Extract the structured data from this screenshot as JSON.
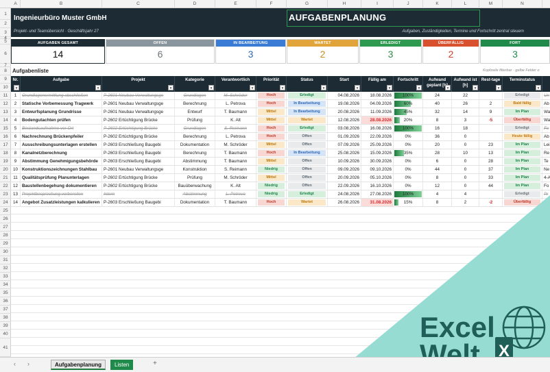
{
  "columns": [
    "A",
    "B",
    "C",
    "D",
    "E",
    "F",
    "G",
    "H",
    "I",
    "J",
    "K",
    "L",
    "M",
    "N",
    "O"
  ],
  "rows": [
    "1",
    "2",
    "3",
    "4",
    "5",
    "6",
    "7",
    "8",
    "9",
    "10",
    "11",
    "12",
    "13",
    "14",
    "15",
    "16",
    "17",
    "18",
    "19",
    "20",
    "21",
    "22",
    "23",
    "24",
    "25",
    "26",
    "27",
    "28",
    "29",
    "30",
    "31",
    "32",
    "33",
    "34",
    "35",
    "36",
    "37",
    "38",
    "39",
    "40",
    "41"
  ],
  "header": {
    "company": "Ingenieurbüro Muster GmbH",
    "sheet_title": "AUFGABENPLANUNG",
    "subtitle": "Projekt- und Teamübersicht · Geschäftsjahr 27",
    "subtitle_right": "Aufgaben, Zuständigkeiten, Termine und Fortschritt zentral steuern"
  },
  "kpis": [
    {
      "label": "AUFGABEN GESAMT",
      "value": "14",
      "color": "#1d2b34",
      "text": "#111111"
    },
    {
      "label": "OFFEN",
      "value": "6",
      "color": "#8a969d",
      "text": "#6b7378"
    },
    {
      "label": "IN BEARBEITUNG",
      "value": "3",
      "color": "#3a7bd5",
      "text": "#2d66b8"
    },
    {
      "label": "WARTET",
      "value": "2",
      "color": "#e0a43a",
      "text": "#c98d23"
    },
    {
      "label": "ERLEDIGT",
      "value": "3",
      "color": "#2e9a4f",
      "text": "#2e8a48"
    },
    {
      "label": "ÜBERFÄLLIG",
      "value": "2",
      "color": "#d9502f",
      "text": "#c8432a"
    },
    {
      "label": "FORT",
      "value": "3",
      "color": "#1f8a4a",
      "text": "#1f8a4a"
    }
  ],
  "list_label": "Aufgabenliste",
  "list_hint": "Kopfzeile filterbar · gelbe Felder o",
  "table": {
    "headers": [
      "Nr.",
      "Aufgabe",
      "Projekt",
      "Kategorie",
      "Verantwortlich",
      "Priorität",
      "Status",
      "Start",
      "Fällig am",
      "Fortschritt",
      "Aufwand geplant [h]",
      "Aufwand ist [h]",
      "Rest-tage",
      "Terminstatus",
      "N"
    ],
    "rows": [
      {
        "nr": "1",
        "task": "Grundlagenermittlung abschließen",
        "project": "P-2601 Neubau Verwaltungsge",
        "category": "Grundlagen",
        "owner": "M. Schröder",
        "prio": "Hoch",
        "status": "Erledigt",
        "start": "04.08.2026",
        "due": "18.08.2026",
        "progress": "100%",
        "progress_value": 1.0,
        "plan": "24",
        "actual": "22",
        "rest": "",
        "termin": "Erledigt",
        "note": "Un",
        "done": true,
        "due_red": false,
        "rest_red": false
      },
      {
        "nr": "2",
        "task": "Statische Vorbemessung Tragwerk",
        "project": "P-2601 Neubau Verwaltungsge",
        "category": "Berechnung",
        "owner": "L. Petrova",
        "prio": "Hoch",
        "status": "In Bearbeitung",
        "start": "19.08.2026",
        "due": "04.09.2026",
        "progress": "60%",
        "progress_value": 0.6,
        "plan": "40",
        "actual": "26",
        "rest": "2",
        "termin": "Bald fällig",
        "note": "Ab",
        "done": false,
        "due_red": false,
        "rest_red": false
      },
      {
        "nr": "3",
        "task": "Entwurfsplanung Grundrisse",
        "project": "P-2601 Neubau Verwaltungsge",
        "category": "Entwurf",
        "owner": "T. Baumann",
        "prio": "Mittel",
        "status": "In Bearbeitung",
        "start": "20.08.2026",
        "due": "11.09.2026",
        "progress": "45%",
        "progress_value": 0.45,
        "plan": "32",
        "actual": "14",
        "rest": "9",
        "termin": "Im Plan",
        "note": "Wa",
        "done": false,
        "due_red": false,
        "rest_red": false
      },
      {
        "nr": "4",
        "task": "Bodengutachten prüfen",
        "project": "P-2602 Ertüchtigung Brücke",
        "category": "Prüfung",
        "owner": "K. Alt",
        "prio": "Mittel",
        "status": "Wartet",
        "start": "12.08.2026",
        "due": "28.08.2026",
        "progress": "20%",
        "progress_value": 0.2,
        "plan": "8",
        "actual": "3",
        "rest": "-5",
        "termin": "Überfällig",
        "note": "Wa",
        "done": false,
        "due_red": true,
        "rest_red": true
      },
      {
        "nr": "5",
        "task": "Bestandsaufnahme vor Ort",
        "project": "P-2602 Ertüchtigung Brücke",
        "category": "Grundlagen",
        "owner": "S. Reimann",
        "prio": "Hoch",
        "status": "Erledigt",
        "start": "03.08.2026",
        "due": "16.08.2026",
        "progress": "100%",
        "progress_value": 1.0,
        "plan": "16",
        "actual": "18",
        "rest": "",
        "termin": "Erledigt",
        "note": "Fo",
        "done": true,
        "due_red": false,
        "rest_red": false
      },
      {
        "nr": "6",
        "task": "Nachrechnung Brückenpfeiler",
        "project": "P-2602 Ertüchtigung Brücke",
        "category": "Berechnung",
        "owner": "L. Petrova",
        "prio": "Hoch",
        "status": "Offen",
        "start": "01.09.2026",
        "due": "22.09.2026",
        "progress": "0%",
        "progress_value": 0.0,
        "plan": "36",
        "actual": "0",
        "rest": "",
        "termin": "Heute fällig",
        "note": "Ab",
        "done": false,
        "due_red": false,
        "rest_red": false
      },
      {
        "nr": "7",
        "task": "Ausschreibungsunterlagen erstellen",
        "project": "P-2603 Erschließung Baugebi",
        "category": "Dokumentation",
        "owner": "M. Schröder",
        "prio": "Mittel",
        "status": "Offen",
        "start": "07.09.2026",
        "due": "25.09.2026",
        "progress": "0%",
        "progress_value": 0.0,
        "plan": "20",
        "actual": "0",
        "rest": "23",
        "termin": "Im Plan",
        "note": "Lei",
        "done": false,
        "due_red": false,
        "rest_red": false
      },
      {
        "nr": "8",
        "task": "Kanalnetzberechnung",
        "project": "P-2603 Erschließung Baugebi",
        "category": "Berechnung",
        "owner": "T. Baumann",
        "prio": "Hoch",
        "status": "In Bearbeitung",
        "start": "25.08.2026",
        "due": "15.09.2026",
        "progress": "35%",
        "progress_value": 0.35,
        "plan": "28",
        "actual": "10",
        "rest": "13",
        "termin": "Im Plan",
        "note": "Re",
        "done": false,
        "due_red": false,
        "rest_red": false
      },
      {
        "nr": "9",
        "task": "Abstimmung Genehmigungsbehörde",
        "project": "P-2603 Erschließung Baugebi",
        "category": "Abstimmung",
        "owner": "T. Baumann",
        "prio": "Mittel",
        "status": "Offen",
        "start": "10.09.2026",
        "due": "30.09.2026",
        "progress": "0%",
        "progress_value": 0.0,
        "plan": "6",
        "actual": "0",
        "rest": "28",
        "termin": "Im Plan",
        "note": "Te",
        "done": false,
        "due_red": false,
        "rest_red": false
      },
      {
        "nr": "10",
        "task": "Konstruktionszeichnungen Stahlbau",
        "project": "P-2601 Neubau Verwaltungsge",
        "category": "Konstruktion",
        "owner": "S. Reimann",
        "prio": "Niedrig",
        "status": "Offen",
        "start": "09.09.2026",
        "due": "09.10.2026",
        "progress": "0%",
        "progress_value": 0.0,
        "plan": "44",
        "actual": "0",
        "rest": "37",
        "termin": "Im Plan",
        "note": "Ne",
        "done": false,
        "due_red": false,
        "rest_red": false
      },
      {
        "nr": "11",
        "task": "Qualitätsprüfung Planunterlagen",
        "project": "P-2602 Ertüchtigung Brücke",
        "category": "Prüfung",
        "owner": "M. Schröder",
        "prio": "Mittel",
        "status": "Offen",
        "start": "20.09.2026",
        "due": "05.10.2026",
        "progress": "0%",
        "progress_value": 0.0,
        "plan": "8",
        "actual": "0",
        "rest": "33",
        "termin": "Im Plan",
        "note": "4-A",
        "done": false,
        "due_red": false,
        "rest_red": false
      },
      {
        "nr": "12",
        "task": "Baustellenbegehung dokumentieren",
        "project": "P-2602 Ertüchtigung Brücke",
        "category": "Bauüberwachung",
        "owner": "K. Alt",
        "prio": "Niedrig",
        "status": "Offen",
        "start": "22.09.2026",
        "due": "16.10.2026",
        "progress": "0%",
        "progress_value": 0.0,
        "plan": "12",
        "actual": "0",
        "rest": "44",
        "termin": "Im Plan",
        "note": "Fo",
        "done": false,
        "due_red": false,
        "rest_red": false
      },
      {
        "nr": "13",
        "task": "Projektbesprechung vorbereiten",
        "project": "Intern",
        "category": "Abstimmung",
        "owner": "L. Petrova",
        "prio": "Niedrig",
        "status": "Erledigt",
        "start": "24.08.2026",
        "due": "27.08.2026",
        "progress": "100%",
        "progress_value": 1.0,
        "plan": "4",
        "actual": "4",
        "rest": "",
        "termin": "Erledigt",
        "note": "Pr",
        "done": true,
        "due_red": false,
        "rest_red": false
      },
      {
        "nr": "14",
        "task": "Angebot Zusatzleistungen kalkulieren",
        "project": "P-2603 Erschließung Baugebi",
        "category": "Dokumentation",
        "owner": "T. Baumann",
        "prio": "Hoch",
        "status": "Wartet",
        "start": "26.08.2026",
        "due": "31.08.2026",
        "progress": "15%",
        "progress_value": 0.15,
        "plan": "8",
        "actual": "2",
        "rest": "-2",
        "termin": "Überfällig",
        "note": "Wa",
        "done": false,
        "due_red": true,
        "rest_red": true
      }
    ]
  },
  "styles": {
    "prio": {
      "Hoch": {
        "bg": "#f8d7d3",
        "fg": "#c0392b"
      },
      "Mittel": {
        "bg": "#fbe8c8",
        "fg": "#b9770e"
      },
      "Niedrig": {
        "bg": "#d5efdc",
        "fg": "#1e8449"
      }
    },
    "status": {
      "Erledigt": {
        "bg": "#d5efdc",
        "fg": "#1e8449"
      },
      "In Bearbeitung": {
        "bg": "#d6e4f7",
        "fg": "#2d66b8"
      },
      "Wartet": {
        "bg": "#fbe8c8",
        "fg": "#b9770e"
      },
      "Offen": {
        "bg": "#e8eaec",
        "fg": "#5d6870"
      }
    },
    "termin": {
      "Erledigt": {
        "bg": "#e8eaec",
        "fg": "#6b7378"
      },
      "Bald fällig": {
        "bg": "#fbe8c8",
        "fg": "#b9770e"
      },
      "Im Plan": {
        "bg": "#d5efdc",
        "fg": "#1e8449"
      },
      "Überfällig": {
        "bg": "#f8d7d3",
        "fg": "#c0392b"
      },
      "Heute fällig": {
        "bg": "#fbe8c8",
        "fg": "#c07a10"
      }
    }
  },
  "tabs": {
    "active": "Aufgabenplanung",
    "second": "Listen",
    "add": "+"
  },
  "watermark": {
    "line1": "Excel",
    "line2": "Welt",
    "color": "#1f5f58",
    "bg": "#96dcd3"
  }
}
